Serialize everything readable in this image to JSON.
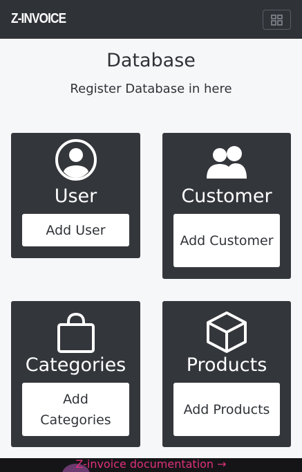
{
  "navbar": {
    "brand": "Z-INVOICE",
    "toggle_icon": "grid-icon"
  },
  "header": {
    "title": "Database",
    "subtitle": "Register Database in here"
  },
  "cards": [
    {
      "label": "User",
      "button": "Add User",
      "icon": "user-circle-icon"
    },
    {
      "label": "Customer",
      "button": "Add Customer",
      "icon": "users-icon"
    },
    {
      "label": "Categories",
      "button": "Add Categories",
      "icon": "shopping-bag-icon"
    },
    {
      "label": "Products",
      "button": "Add Products",
      "icon": "box-icon"
    }
  ],
  "footer": {
    "link": "Z-invoice documentation →"
  },
  "colors": {
    "navbar": "#2f3237",
    "card": "#33363b",
    "background": "#f6f7f9",
    "footer_link": "#e0307a"
  }
}
